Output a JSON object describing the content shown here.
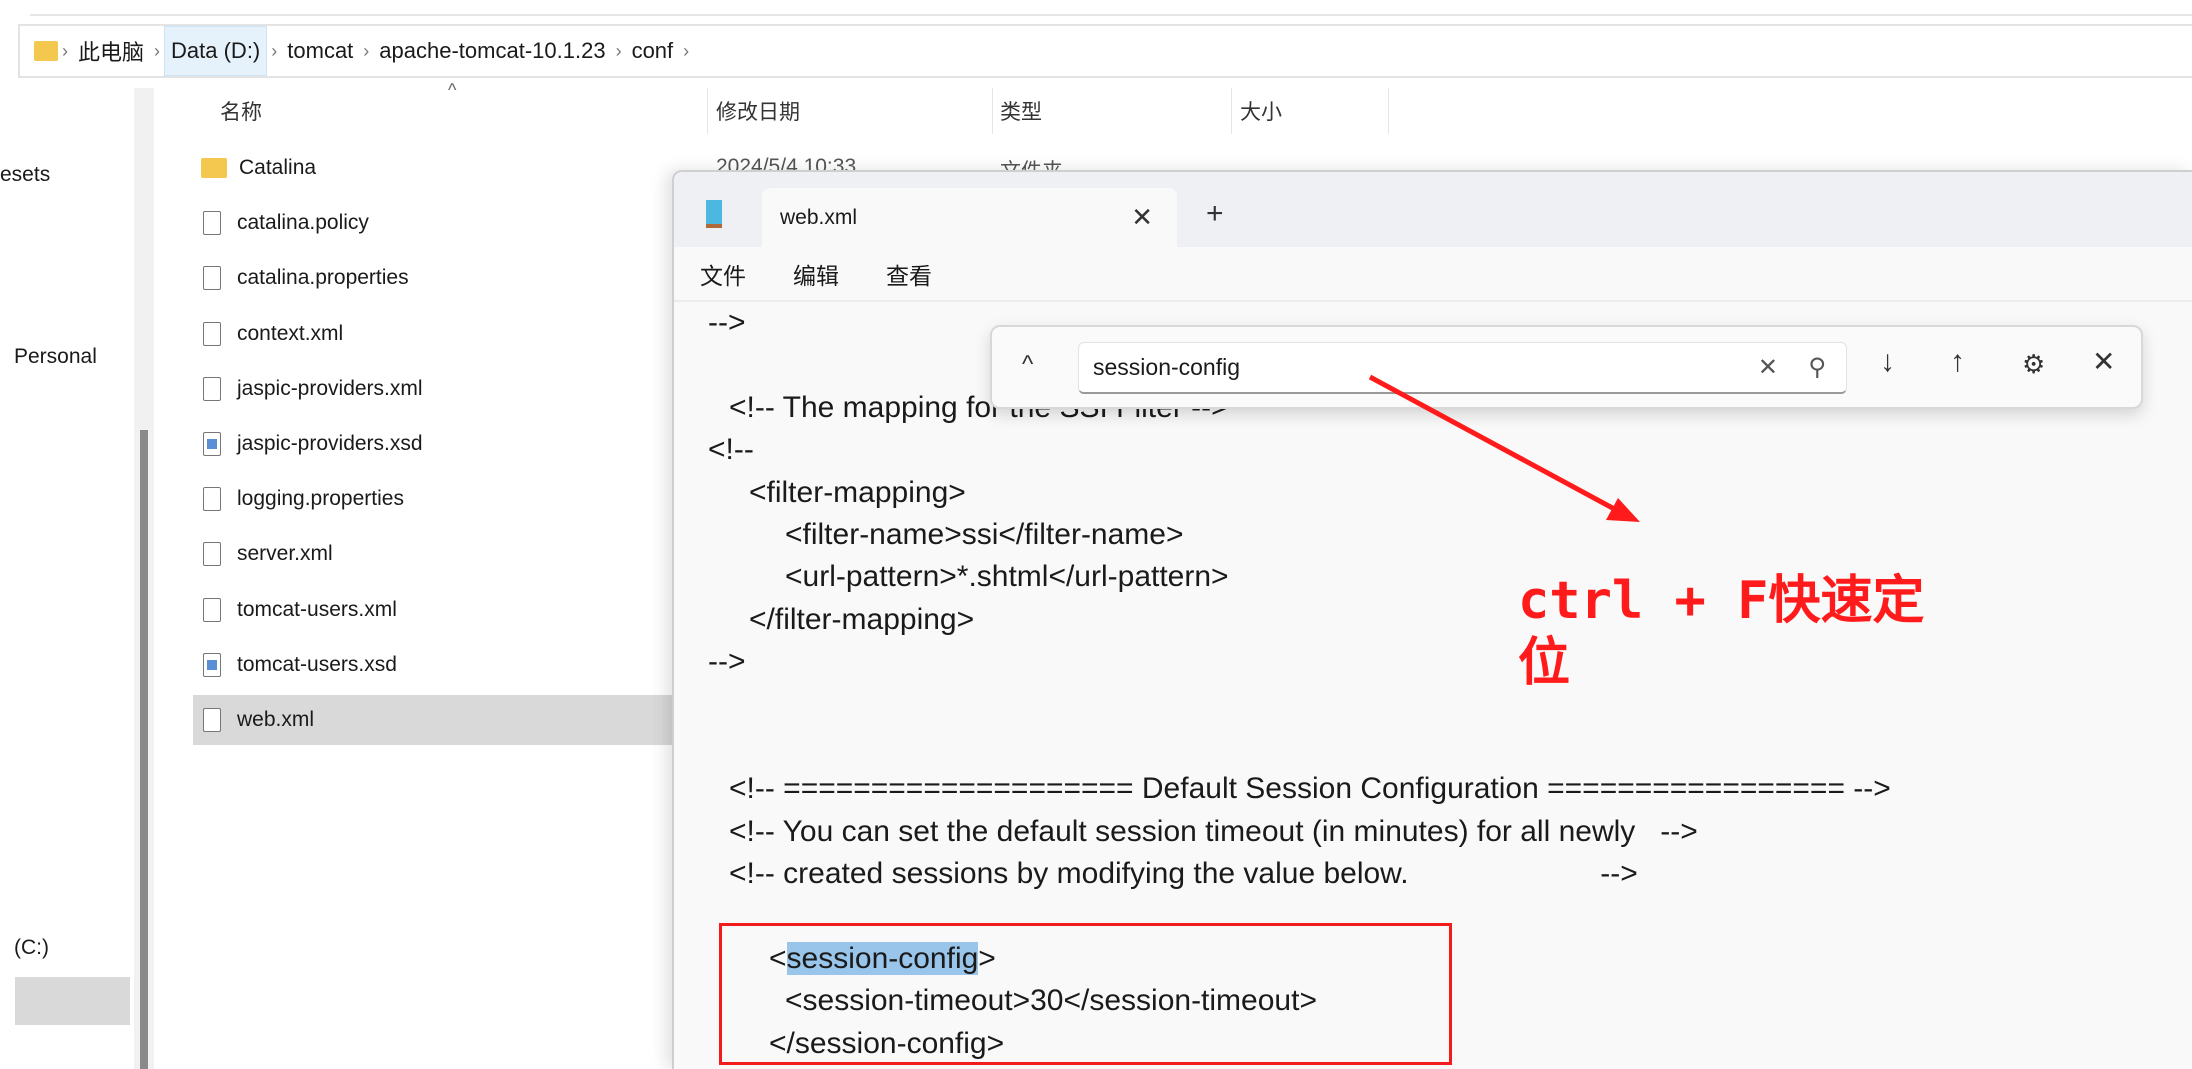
{
  "explorer": {
    "breadcrumb": [
      "此电脑",
      "Data (D:)",
      "tomcat",
      "apache-tomcat-10.1.23",
      "conf"
    ],
    "nav": [
      "esets",
      "Personal",
      "(C:)"
    ],
    "columns": [
      "名称",
      "修改日期",
      "类型",
      "大小"
    ],
    "files": [
      {
        "name": "Catalina",
        "type": "folder",
        "date": "2024/5/4 10:33",
        "kind": "文件夹"
      },
      {
        "name": "catalina.policy",
        "type": "file"
      },
      {
        "name": "catalina.properties",
        "type": "file"
      },
      {
        "name": "context.xml",
        "type": "file"
      },
      {
        "name": "jaspic-providers.xml",
        "type": "file"
      },
      {
        "name": "jaspic-providers.xsd",
        "type": "xsd"
      },
      {
        "name": "logging.properties",
        "type": "file"
      },
      {
        "name": "server.xml",
        "type": "file"
      },
      {
        "name": "tomcat-users.xml",
        "type": "file"
      },
      {
        "name": "tomcat-users.xsd",
        "type": "xsd"
      },
      {
        "name": "web.xml",
        "type": "file",
        "selected": true
      }
    ]
  },
  "notepad": {
    "tab": "web.xml",
    "menu": [
      "文件",
      "编辑",
      "查看"
    ],
    "find": {
      "value": "session-config"
    },
    "code": {
      "l0": "-->",
      "l2": "<!-- The mapping for the SSI Filter -->",
      "l3": "<!--",
      "l4": "<filter-mapping>",
      "l5": "<filter-name>ssi</filter-name>",
      "l6": "<url-pattern>*.shtml</url-pattern>",
      "l7": "</filter-mapping>",
      "l8": "-->",
      "l11": "<!-- ==================== Default Session Configuration ================= -->",
      "l12": "<!-- You can set the default session timeout (in minutes) for all newly   -->",
      "l13": "<!-- created sessions by modifying the value below.                       -->",
      "l15a": "<",
      "l15b": "session-config",
      "l15c": ">",
      "l16": "<session-timeout>30</session-timeout>",
      "l17": "</session-config>"
    }
  },
  "annotation": {
    "text": "ctrl + F快速定位",
    "color": "#ff1b1b"
  }
}
